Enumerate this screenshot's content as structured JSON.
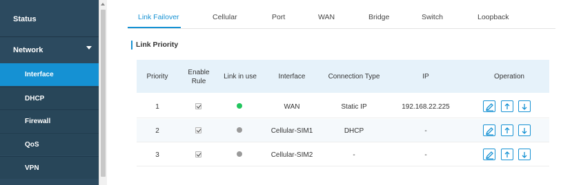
{
  "sidebar": {
    "status": "Status",
    "network": "Network",
    "sub_items": [
      "Interface",
      "DHCP",
      "Firewall",
      "QoS",
      "VPN"
    ]
  },
  "tabs": [
    "Link Failover",
    "Cellular",
    "Port",
    "WAN",
    "Bridge",
    "Switch",
    "Loopback"
  ],
  "active_tab": "Link Failover",
  "section_title": "Link Priority",
  "table": {
    "headers": {
      "priority": "Priority",
      "enable_rule_1": "Enable",
      "enable_rule_2": "Rule",
      "link_in_use": "Link in use",
      "interface": "Interface",
      "connection_type": "Connection Type",
      "ip": "IP",
      "operation": "Operation"
    },
    "rows": [
      {
        "priority": "1",
        "enabled": true,
        "link_status_color": "#22c55e",
        "interface": "WAN",
        "connection_type": "Static IP",
        "ip": "192.168.22.225"
      },
      {
        "priority": "2",
        "enabled": true,
        "link_status_color": "#9a9a9a",
        "interface": "Cellular-SIM1",
        "connection_type": "DHCP",
        "ip": "-"
      },
      {
        "priority": "3",
        "enabled": true,
        "link_status_color": "#9a9a9a",
        "interface": "Cellular-SIM2",
        "connection_type": "-",
        "ip": "-"
      }
    ]
  },
  "colors": {
    "accent": "#1591d3",
    "sidebar_bg": "#2c4a5f",
    "header_bg": "#e6f2fa"
  },
  "icons": {
    "edit": "edit-icon",
    "up": "arrow-up-icon",
    "down": "arrow-down-icon"
  }
}
